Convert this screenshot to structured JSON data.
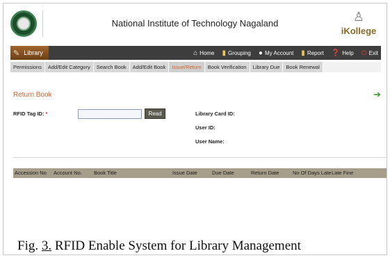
{
  "header": {
    "institute_name": "National Institute of Technology Nagaland",
    "brand": "iKollege"
  },
  "navbar": {
    "module_label": "Library",
    "items": [
      {
        "label": "Home",
        "icon": "home-icon"
      },
      {
        "label": "Grouping",
        "icon": "grouping-icon"
      },
      {
        "label": "My Account",
        "icon": "account-icon"
      },
      {
        "label": "Report",
        "icon": "report-icon"
      },
      {
        "label": "Help",
        "icon": "help-icon"
      },
      {
        "label": "Exit",
        "icon": "exit-icon"
      }
    ]
  },
  "subtabs": [
    {
      "label": "Permissions"
    },
    {
      "label": "Add/Edit Category"
    },
    {
      "label": "Search Book"
    },
    {
      "label": "Add/Edit Book"
    },
    {
      "label": "Issue/Return",
      "active": true
    },
    {
      "label": "Book Verification"
    },
    {
      "label": "Library Due"
    },
    {
      "label": "Book Renewal"
    }
  ],
  "page": {
    "title": "Return Book"
  },
  "form": {
    "rfid_label": "RFID Tag ID:",
    "required_mark": "*",
    "rfid_value": "",
    "read_button": "Read",
    "library_card_label": "Library Card ID:",
    "user_id_label": "User ID:",
    "user_name_label": "User Name:"
  },
  "table": {
    "columns": [
      "Accession No",
      "Account No.",
      "Book Title",
      "Issue Date",
      "Due Date",
      "Return Date",
      "No Of Days Late",
      "Late Fine"
    ],
    "rows": []
  },
  "caption": {
    "prefix": "Fig. ",
    "number": "3.",
    "text": " RFID Enable System for Library Management"
  },
  "colors": {
    "accent": "#d0602a",
    "navbar_bg": "#3d3d3d",
    "table_header_bg": "#a79d8b"
  }
}
